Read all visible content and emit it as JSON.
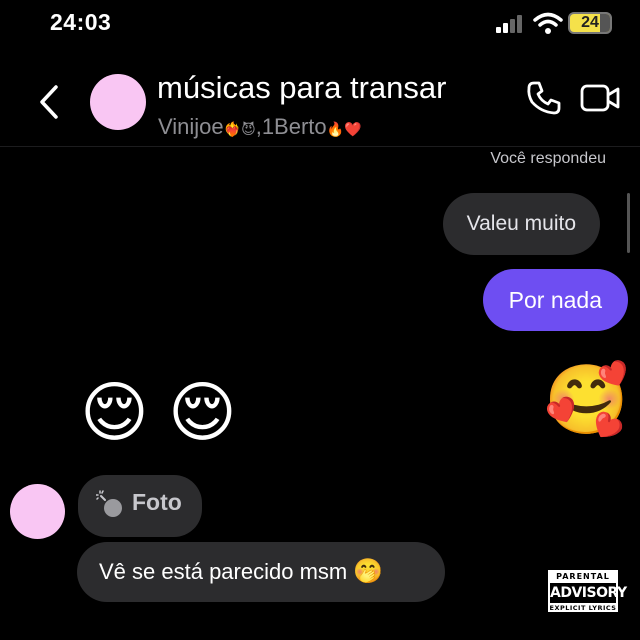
{
  "status_bar": {
    "time": "24:03",
    "battery": "24"
  },
  "header": {
    "title": "músicas para transar",
    "subtitle_name_1": "Vinijoe",
    "subtitle_emoji_1": "❤️‍🔥😈",
    "subtitle_sep": ",",
    "subtitle_name_2": "1Berto",
    "subtitle_emoji_2": "🔥❤️"
  },
  "thread": {
    "replied_label": "Você respondeu",
    "messages": [
      {
        "text": "Valeu muito"
      },
      {
        "text": "Por nada"
      }
    ],
    "emoji_left_1": "😌",
    "emoji_left_2": "😌",
    "emoji_right": "🥰",
    "photo_label": "Foto",
    "last_message": "Vê se está parecido msm",
    "last_message_emoji": "🤭"
  },
  "parental_advisory": {
    "top": "PARENTAL",
    "middle": "ADVISORY",
    "bottom": "EXPLICIT LYRICS"
  },
  "colors": {
    "background": "#000000",
    "sent_bubble": "#6e4ef2",
    "received_bubble": "#2c2c2e",
    "avatar": "#f9c6f3"
  }
}
